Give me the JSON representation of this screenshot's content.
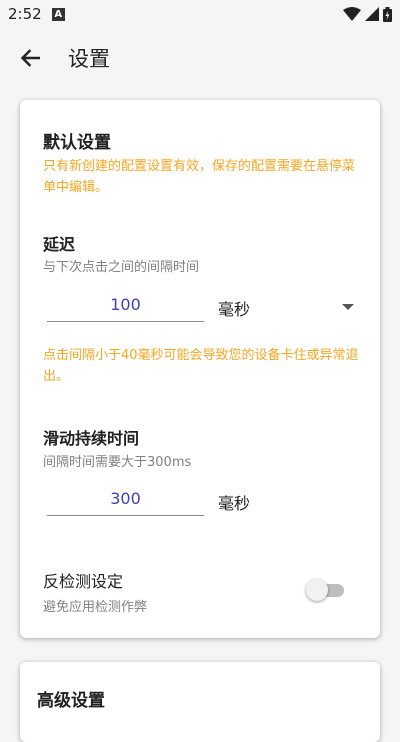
{
  "status_bar": {
    "time": "2:52",
    "notification_icon": "a-icon",
    "indicators": [
      "wifi-icon",
      "signal-icon",
      "battery-icon"
    ]
  },
  "app_bar": {
    "title": "设置",
    "back_icon": "arrow-back-icon"
  },
  "default_settings": {
    "title": "默认设置",
    "warning": "只有新创建的配置设置有效，保存的配置需要在悬停菜单中编辑。",
    "delay": {
      "title": "延迟",
      "description": "与下次点击之间的间隔时间",
      "value": "100",
      "unit": "毫秒",
      "warning": "点击间隔小于40毫秒可能会导致您的设备卡住或异常退出。"
    },
    "swipe": {
      "title": "滑动持续时间",
      "description": "间隔时间需要大于300ms",
      "value": "300",
      "unit": "毫秒"
    },
    "anti_detection": {
      "title": "反检测设定",
      "description": "避免应用检测作弊",
      "enabled": false
    }
  },
  "advanced_settings": {
    "title": "高级设置"
  },
  "colors": {
    "accent": "#3f3fb5",
    "warning": "#f5a623",
    "secondary_text": "#808080"
  }
}
